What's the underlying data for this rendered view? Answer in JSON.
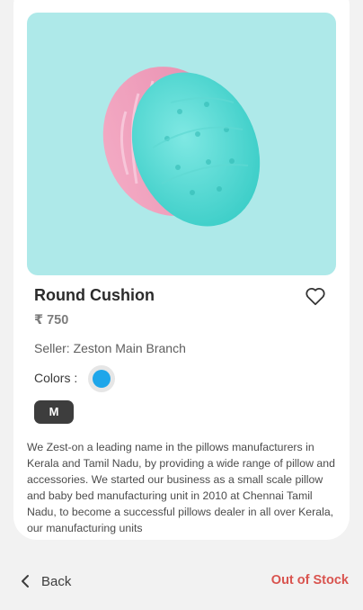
{
  "product": {
    "title": "Round Cushion",
    "price": "₹ 750",
    "seller": "Seller: Zeston Main Branch",
    "colors_label": "Colors :",
    "selected_color": "#1ea6ea",
    "size": "M",
    "image_background": "#aee9e9",
    "description": "We Zest-on a leading name in the pillows manufacturers in Kerala and Tamil Nadu, by providing a wide range of pillow and accessories. We started our business as a small scale pillow and baby bed manufacturing unit in 2010 at Chennai Tamil Nadu, to become a successful pillows dealer in all over Kerala, our manufacturing units"
  },
  "icons": {
    "wishlist": "heart-outline-icon",
    "back": "chevron-left-icon"
  },
  "footer": {
    "back_label": "Back",
    "stock_status": "Out of Stock",
    "stock_color": "#d9544f"
  }
}
